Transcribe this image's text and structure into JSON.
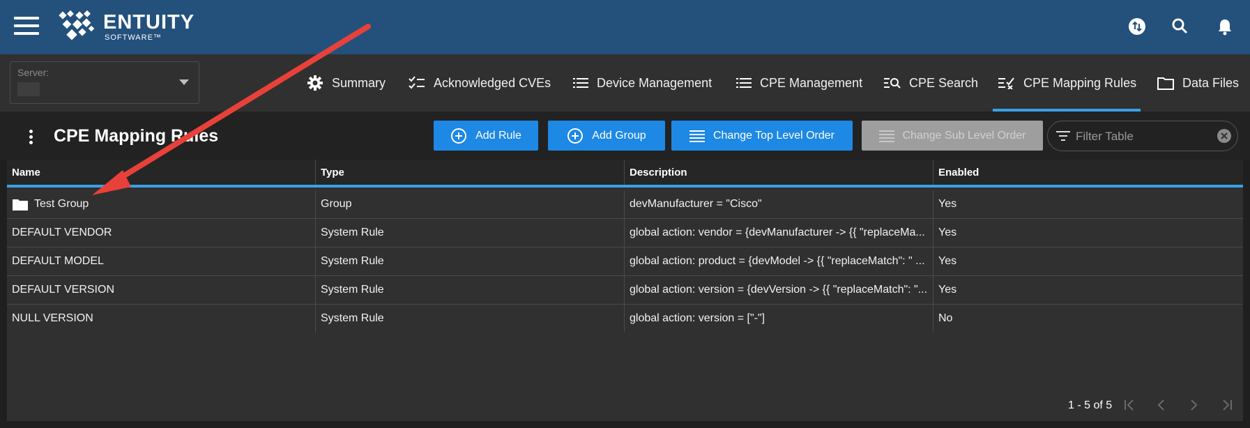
{
  "brand": {
    "name": "ENTUITY",
    "sub": "SOFTWARE™"
  },
  "header_icons": [
    "sync-icon",
    "search-icon",
    "bell-icon"
  ],
  "server": {
    "label": "Server:",
    "value": ""
  },
  "tabs": [
    {
      "label": "Summary",
      "icon": "gear-icon"
    },
    {
      "label": "Acknowledged CVEs",
      "icon": "checklist-icon"
    },
    {
      "label": "Device Management",
      "icon": "list-icon"
    },
    {
      "label": "CPE Management",
      "icon": "list-icon"
    },
    {
      "label": "CPE Search",
      "icon": "search-list-icon"
    },
    {
      "label": "CPE Mapping Rules",
      "icon": "rule-check-icon",
      "active": true
    },
    {
      "label": "Data Files",
      "icon": "folder-icon"
    }
  ],
  "page": {
    "title": "CPE Mapping Rules",
    "buttons": {
      "add_rule": "Add Rule",
      "add_group": "Add Group",
      "change_top": "Change Top Level Order",
      "change_sub": "Change Sub Level Order"
    },
    "filter_placeholder": "Filter Table"
  },
  "table": {
    "columns": [
      "Name",
      "Type",
      "Description",
      "Enabled"
    ],
    "rows": [
      {
        "name": "Test Group",
        "type": "Group",
        "description": "devManufacturer = \"Cisco\"",
        "enabled": "Yes"
      },
      {
        "name": "DEFAULT VENDOR",
        "type": "System Rule",
        "description": "global action: vendor = {devManufacturer -> {{ \"replaceMa...",
        "enabled": "Yes"
      },
      {
        "name": "DEFAULT MODEL",
        "type": "System Rule",
        "description": "global action: product = {devModel -> {{ \"replaceMatch\": \" ...",
        "enabled": "Yes"
      },
      {
        "name": "DEFAULT VERSION",
        "type": "System Rule",
        "description": "global action: version = {devVersion -> {{ \"replaceMatch\": \"...",
        "enabled": "Yes"
      },
      {
        "name": "NULL VERSION",
        "type": "System Rule",
        "description": "global action: version = [\"-\"]",
        "enabled": "No"
      }
    ],
    "pager": "1 - 5 of 5"
  },
  "colors": {
    "accent": "#1e88e5",
    "topbar": "#23517c",
    "tab_underline": "#3aa0e8",
    "annotation": "#e8413a"
  }
}
